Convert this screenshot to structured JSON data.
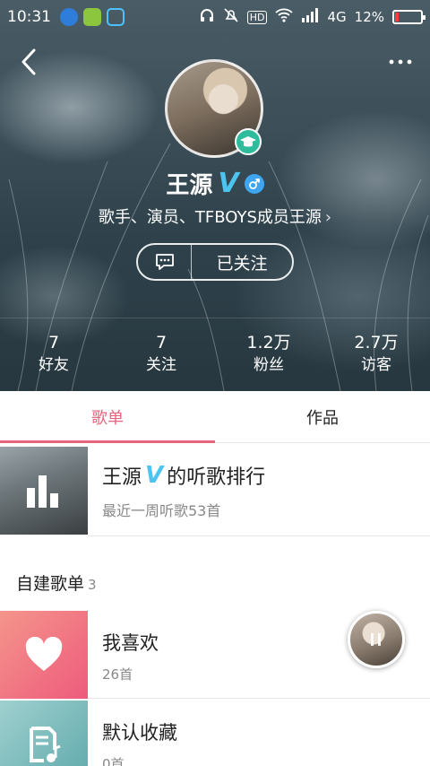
{
  "status_bar": {
    "time": "10:31",
    "network": "4G",
    "battery": "12%",
    "battery_level": 0.12
  },
  "profile": {
    "name": "王源",
    "description": "歌手、演员、TFBOYS成员王源",
    "follow_label": "已关注"
  },
  "stats": [
    {
      "num": "7",
      "label": "好友"
    },
    {
      "num": "7",
      "label": "关注"
    },
    {
      "num": "1.2万",
      "label": "粉丝"
    },
    {
      "num": "2.7万",
      "label": "访客"
    }
  ],
  "tabs": [
    {
      "label": "歌单",
      "active": true
    },
    {
      "label": "作品",
      "active": false
    }
  ],
  "ranking": {
    "name": "王源",
    "suffix": "的听歌排行",
    "subtitle": "最近一周听歌53首"
  },
  "section": {
    "title": "自建歌单",
    "count": "3"
  },
  "playlists": [
    {
      "title": "我喜欢",
      "count": "26首",
      "cover_color": "#f06f86"
    },
    {
      "title": "默认收藏",
      "count": "0首",
      "cover_color": "#6fb3b3"
    }
  ],
  "colors": {
    "accent": "#e8647e",
    "verified": "#4dc3f0",
    "badge": "#2ebc9d"
  }
}
